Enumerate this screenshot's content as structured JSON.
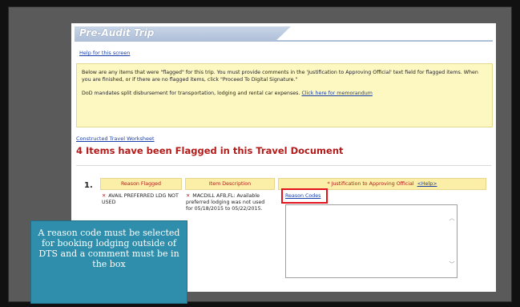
{
  "page": {
    "title": "Pre-Audit Trip",
    "help_link": "Help for this screen"
  },
  "notice": {
    "paragraph1": "Below are any items that were \"flagged\" for this trip. You must provide comments in the 'Justification to Approving Official' text field for flagged items. When you are finished, or if there are no flagged items, click \"Proceed To Digital Signature.\"",
    "paragraph2_text": "DoD mandates split disbursement for transportation, lodging and rental car expenses. ",
    "paragraph2_link": "Click here for memorandum"
  },
  "worksheet_link": "Constructed Travel Worksheet",
  "flag_heading": "4 Items have been Flagged in this Travel Document",
  "table": {
    "headers": {
      "reason_flagged": "Reason Flagged",
      "item_description": "Item Description",
      "justification": "* Justification to Approving Official",
      "help_link": "<Help>"
    },
    "rows": [
      {
        "number": "1.",
        "reason": "AVAIL PREFERRED LDG NOT USED",
        "description": "MACDILL AFB,FL: Available preferred lodging was not used for 05/18/2015 to 05/22/2015.",
        "reason_codes_link": "Reason Codes",
        "justification_value": ""
      }
    ]
  },
  "callout": {
    "text": "A reason code must be selected for booking lodging outside of DTS and a comment must be in the box"
  },
  "colors": {
    "accent_red": "#b31b1b",
    "highlight_red": "#e3121b",
    "link_blue": "#1a3fa8",
    "notice_bg": "#fdf7c2",
    "callout_bg": "#2e8eab"
  }
}
